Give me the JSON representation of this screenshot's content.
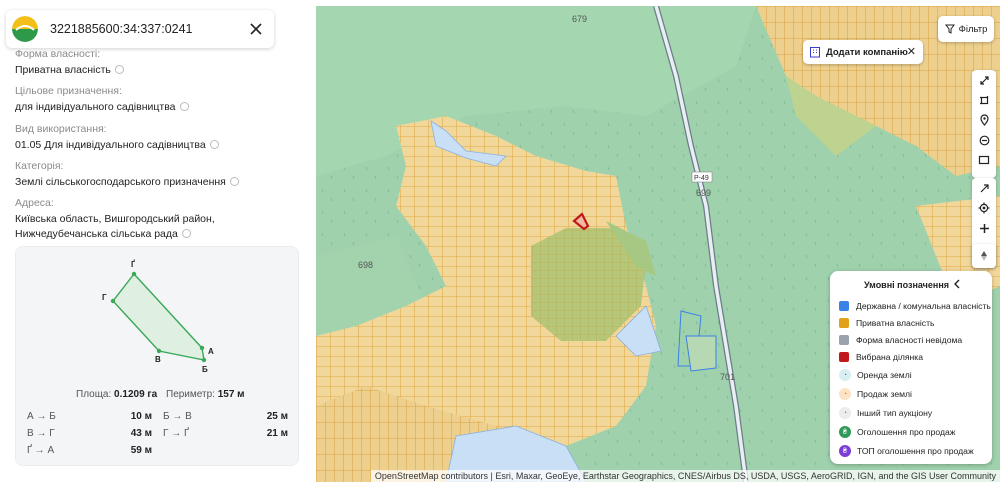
{
  "header": {
    "cadastral_number": "3221885600:34:337:0241",
    "logo_icon": "app-logo-icon",
    "close_icon": "close-icon"
  },
  "properties": [
    {
      "label": "Форма власності:",
      "value": "Приватна власність"
    },
    {
      "label": "Цільове призначення:",
      "value": "для індивідуального садівництва"
    },
    {
      "label": "Вид використання:",
      "value": "01.05 Для індивідуального садівництва"
    },
    {
      "label": "Категорія:",
      "value": "Землі сільськогосподарського призначення"
    },
    {
      "label": "Адреса:",
      "value": "Київська область, Вишгородський район, Нижчедубечанська сільська рада"
    }
  ],
  "parcel_shape": {
    "vertices": [
      "Ґ",
      "Г",
      "В",
      "Б",
      "А"
    ],
    "area_label": "Площа:",
    "area_value": "0.1209 га",
    "perimeter_label": "Периметр:",
    "perimeter_value": "157 м",
    "segments": [
      {
        "name": "А → Б",
        "length": "10 м"
      },
      {
        "name": "Б → В",
        "length": "25 м"
      },
      {
        "name": "В → Г",
        "length": "43 м"
      },
      {
        "name": "Г → Ґ",
        "length": "21 м"
      },
      {
        "name": "Ґ → А",
        "length": "59 м"
      }
    ]
  },
  "map": {
    "labels": [
      "679",
      "698",
      "Р-49",
      "699",
      "701"
    ],
    "filter_label": "Фільтр",
    "add_company_label": "Додати компанію",
    "attribution": "OpenStreetMap contributors | Esri, Maxar, GeoEye, Earthstar Geographics, CNES/Airbus DS, USDA, USGS, AeroGRID, IGN, and the GIS User Community",
    "toolbar_icons": [
      "expand-icon",
      "crop-icon",
      "pin-icon",
      "circle-minus-icon",
      "rectangle-icon",
      "arrow-icon",
      "locate-icon",
      "zoom-in-icon",
      "zoom-out-icon",
      "compass-icon"
    ]
  },
  "legend": {
    "title": "Умовні позначення",
    "items": [
      {
        "label": "Державна / комунальна власність",
        "color": "#3b82e6",
        "kind": "square"
      },
      {
        "label": "Приватна власність",
        "color": "#e0a21a",
        "kind": "square"
      },
      {
        "label": "Форма власності невідома",
        "color": "#9aa3ad",
        "kind": "square"
      },
      {
        "label": "Вибрана ділянка",
        "color": "#c0181b",
        "kind": "square"
      },
      {
        "label": "Оренда землі",
        "color": "#d9eef2",
        "kind": "circle"
      },
      {
        "label": "Продаж землі",
        "color": "#fde3c4",
        "kind": "circle"
      },
      {
        "label": "Інший тип аукціону",
        "color": "#ececec",
        "kind": "circle"
      },
      {
        "label": "Оголошення про продаж",
        "color": "#2f9a57",
        "kind": "circle"
      },
      {
        "label": "ТОП оголошення про продаж",
        "color": "#7b3fd6",
        "kind": "circle"
      }
    ]
  }
}
